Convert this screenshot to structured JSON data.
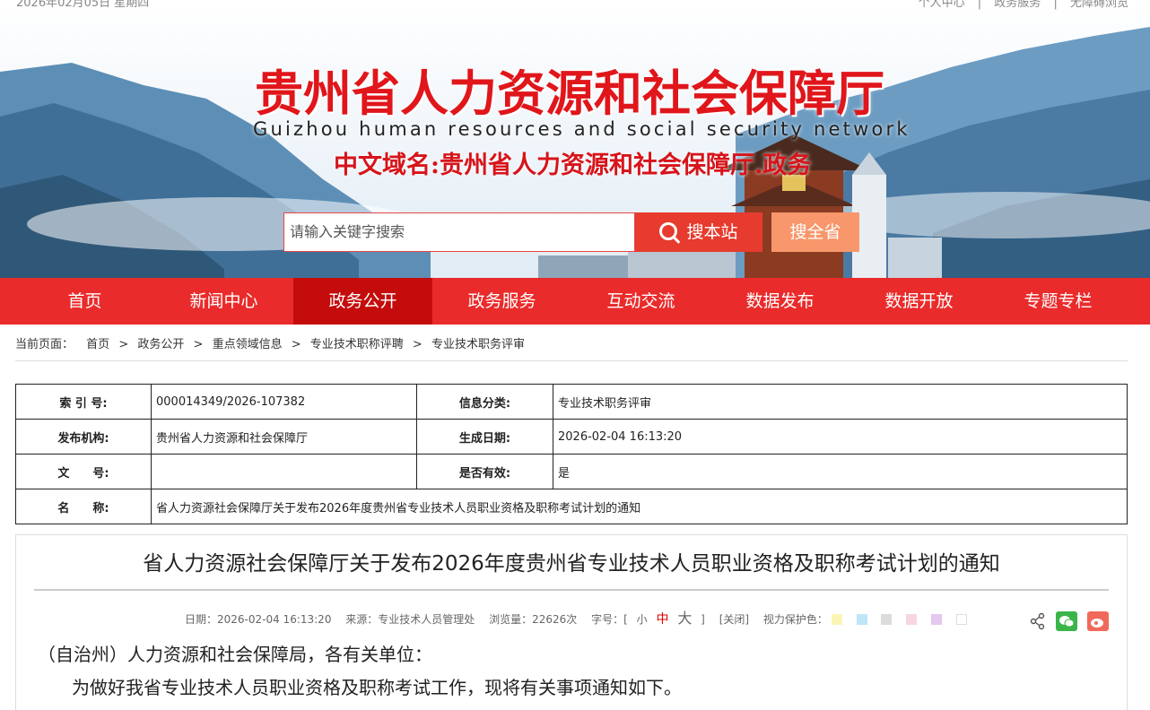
{
  "topbar": {
    "date": "2026年02月05日 星期四",
    "links": [
      "个人中心",
      "|",
      "政务服务",
      "|",
      "无障碍浏览"
    ]
  },
  "header": {
    "title": "贵州省人力资源和社会保障厅",
    "subtitle": "Guizhou human resources and social security network",
    "domain": "中文域名:贵州省人力资源和社会保障厅.政务"
  },
  "search": {
    "placeholder": "请输入关键字搜索",
    "site_button": "搜本站",
    "province_button": "搜全省"
  },
  "nav": {
    "items": [
      "首页",
      "新闻中心",
      "政务公开",
      "政务服务",
      "互动交流",
      "数据发布",
      "数据开放",
      "专题专栏"
    ],
    "active_index": 2
  },
  "breadcrumb": {
    "label": "当前页面：",
    "items": [
      "首页",
      "政务公开",
      "重点领域信息",
      "专业技术职称评聘",
      "专业技术职务评审"
    ],
    "separator": ">"
  },
  "info": {
    "index_label": "索 引 号:",
    "index_value": "000014349/2026-107382",
    "category_label": "信息分类:",
    "category_value": "专业技术职务评审",
    "publisher_label": "发布机构:",
    "publisher_value": "贵州省人力资源和社会保障厅",
    "date_label": "生成日期:",
    "date_value": "2026-02-04 16:13:20",
    "docno_label": "文　　号:",
    "docno_value": "",
    "valid_label": "是否有效:",
    "valid_value": "是",
    "name_label": "名　　称:",
    "name_value": "省人力资源社会保障厅关于发布2026年度贵州省专业技术人员职业资格及职称考试计划的通知"
  },
  "article": {
    "title": "省人力资源社会保障厅关于发布2026年度贵州省专业技术人员职业资格及职称考试计划的通知",
    "meta": {
      "date": "日期：2026-02-04 16:13:20",
      "source": "来源：专业技术人员管理处",
      "views": "浏览量：22626次",
      "font_label": "字号：[",
      "font_small": "小",
      "font_mid": "中",
      "font_large": "大",
      "font_close": "]",
      "close": "[关闭]",
      "eye_label": "视力保护色：",
      "swatches": [
        "#fbf5b8",
        "#bfe6f7",
        "#dcdcdc",
        "#f7d6df",
        "#e3c8f0",
        "#ffffff"
      ]
    },
    "paragraph1": "（自治州）人力资源和社会保障局，各有关单位：",
    "paragraph2": "为做好我省专业技术人员职业资格及职称考试工作，现将有关事项通知如下。"
  }
}
